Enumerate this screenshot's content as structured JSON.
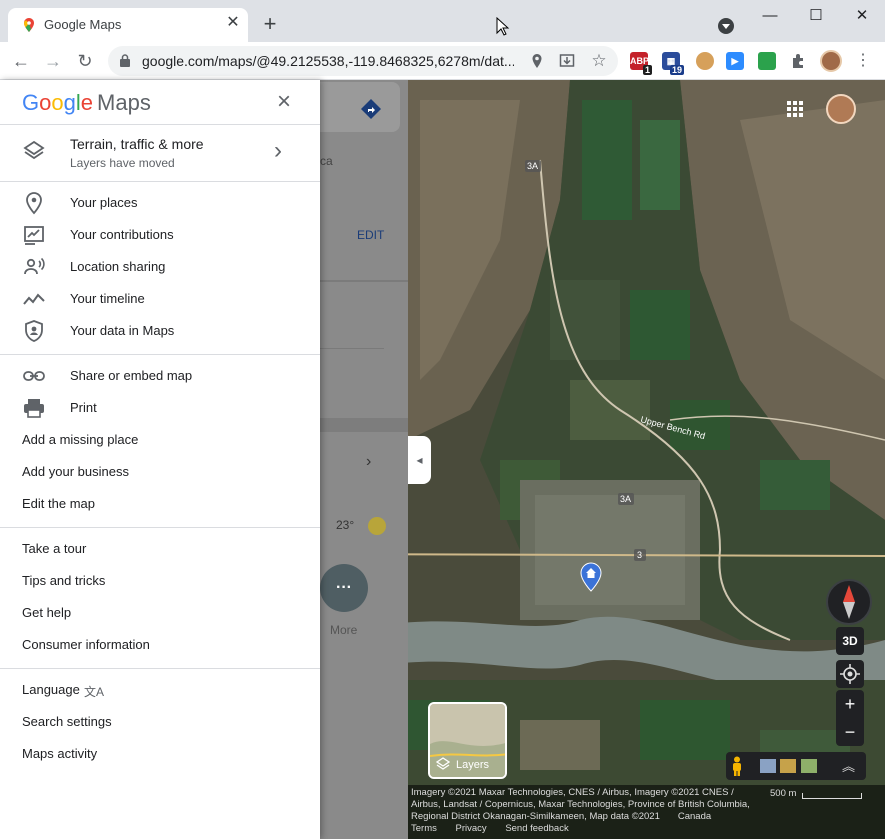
{
  "browser": {
    "tab_title": "Google Maps",
    "tab_close": "✕",
    "new_tab": "+",
    "url": "google.com/maps/@49.2125538,-119.8468325,6278m/dat...",
    "ext_abp_badge": "1",
    "ext_second_badge": "19",
    "window_min": "—",
    "window_max": "☐",
    "window_close": "✕"
  },
  "menu": {
    "logo_google": "Google",
    "logo_maps": "Maps",
    "layers_title": "Terrain, traffic & more",
    "layers_sub": "Layers have moved",
    "items_group1": [
      {
        "label": "Your places",
        "icon": "pin-icon"
      },
      {
        "label": "Your contributions",
        "icon": "contributions-icon"
      },
      {
        "label": "Location sharing",
        "icon": "location-sharing-icon"
      },
      {
        "label": "Your timeline",
        "icon": "timeline-icon"
      },
      {
        "label": "Your data in Maps",
        "icon": "shield-icon"
      }
    ],
    "items_group2": [
      {
        "label": "Share or embed map",
        "icon": "link-icon"
      },
      {
        "label": "Print",
        "icon": "print-icon"
      },
      {
        "label": "Add a missing place"
      },
      {
        "label": "Add your business"
      },
      {
        "label": "Edit the map"
      }
    ],
    "items_group3": [
      {
        "label": "Take a tour"
      },
      {
        "label": "Tips and tricks"
      },
      {
        "label": "Get help"
      },
      {
        "label": "Consumer information"
      }
    ],
    "items_group4": [
      {
        "label": "Language"
      },
      {
        "label": "Search settings"
      },
      {
        "label": "Maps activity"
      }
    ]
  },
  "panel": {
    "edit_label": "EDIT",
    "partial_text": "ca",
    "weather_temp": "23°",
    "more_label": "More"
  },
  "map": {
    "road_labels": [
      "3A",
      "3A",
      "3",
      "3",
      "Upper Bench Rd"
    ],
    "layers_label": "Layers",
    "btn_3d": "3D",
    "zoom_in": "+",
    "zoom_out": "−",
    "attribution_line1": "Imagery ©2021 Maxar Technologies, CNES / Airbus, Imagery ©2021 CNES /",
    "attribution_line2": "Airbus, Landsat / Copernicus, Maxar Technologies, Province of British Columbia,",
    "attribution_line3": "Regional District Okanagan-Similkameen, Map data ©2021",
    "country": "Canada",
    "scale": "500 m",
    "footer_links": [
      "Terms",
      "Privacy",
      "Send feedback"
    ]
  },
  "colors": {
    "accent_blue": "#1a73e8",
    "google_blue": "#4285f4",
    "google_red": "#ea4335",
    "google_yellow": "#fbbc05",
    "google_green": "#34a853"
  }
}
